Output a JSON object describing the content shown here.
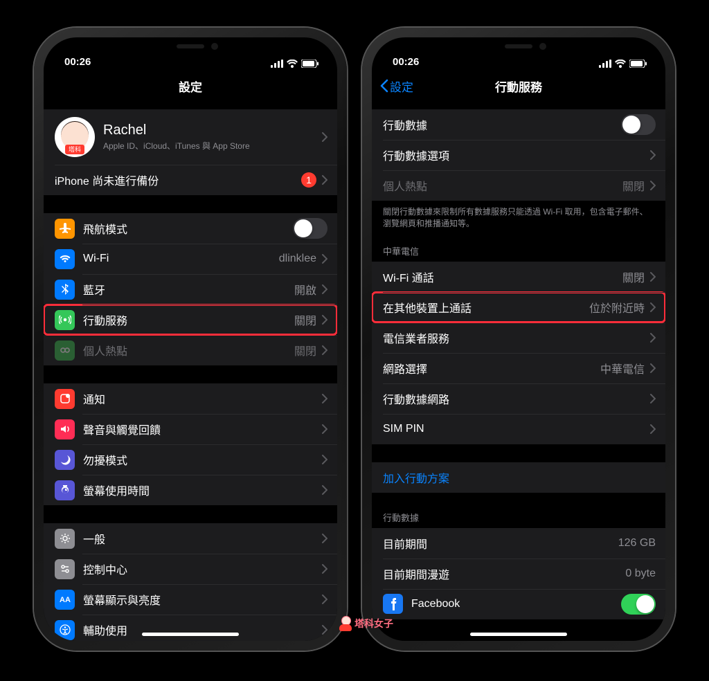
{
  "statusbar": {
    "time": "00:26"
  },
  "left": {
    "title": "設定",
    "profile": {
      "name": "Rachel",
      "sub": "Apple ID、iCloud、iTunes 與 App Store"
    },
    "backup_warning": {
      "label": "iPhone 尚未進行備份",
      "badge": "1"
    },
    "group1": {
      "airplane": "飛航模式",
      "wifi": {
        "label": "Wi-Fi",
        "value": "dlinklee"
      },
      "bluetooth": {
        "label": "藍牙",
        "value": "開啟"
      },
      "cellular": {
        "label": "行動服務",
        "value": "關閉"
      },
      "hotspot": {
        "label": "個人熱點",
        "value": "關閉"
      }
    },
    "group2": {
      "notifications": "通知",
      "sound": "聲音與觸覺回饋",
      "dnd": "勿擾模式",
      "screentime": "螢幕使用時間"
    },
    "group3": {
      "general": "一般",
      "control": "控制中心",
      "display": "螢幕顯示與亮度",
      "accessibility": "輔助使用"
    }
  },
  "right": {
    "back": "設定",
    "title": "行動服務",
    "group1": {
      "cellular_data": "行動數據",
      "options": "行動數據選項",
      "hotspot": {
        "label": "個人熱點",
        "value": "關閉"
      }
    },
    "footer1": "關閉行動數據來限制所有數據服務只能透過 Wi-Fi 取用，包含電子郵件、瀏覽網頁和推播通知等。",
    "header2": "中華電信",
    "group2": {
      "wifi_calling": {
        "label": "Wi-Fi 通話",
        "value": "關閉"
      },
      "other_devices": {
        "label": "在其他裝置上通話",
        "value": "位於附近時"
      },
      "carrier_services": "電信業者服務",
      "network_selection": {
        "label": "網路選擇",
        "value": "中華電信"
      },
      "cellular_network": "行動數據網路",
      "sim_pin": "SIM PIN"
    },
    "add_plan": "加入行動方案",
    "header3": "行動數據",
    "group3": {
      "current_period": {
        "label": "目前期間",
        "value": "126 GB"
      },
      "roaming": {
        "label": "目前期間漫遊",
        "value": "0 byte"
      },
      "facebook": "Facebook"
    }
  },
  "watermark": "塔科女子"
}
